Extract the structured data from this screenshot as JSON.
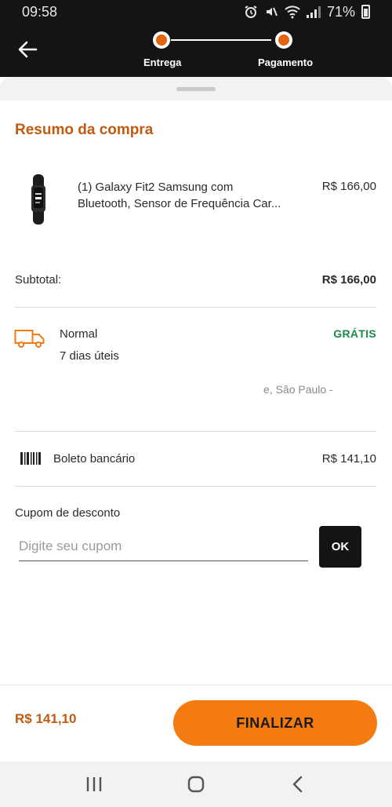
{
  "status_bar": {
    "time": "09:58",
    "battery": "71%",
    "icons": [
      "alarm-icon",
      "mute-icon",
      "wifi-icon",
      "signal-icon",
      "battery-icon"
    ]
  },
  "header": {
    "back_icon": "arrow-left-icon",
    "steps": [
      {
        "label": "Entrega"
      },
      {
        "label": "Pagamento"
      }
    ]
  },
  "summary": {
    "title": "Resumo da compra",
    "product": {
      "name": "(1) Galaxy Fit2 Samsung com Bluetooth, Sensor de Frequência Car...",
      "price": "R$ 166,00",
      "image_icon": "smartband-icon"
    },
    "subtotal_label": "Subtotal:",
    "subtotal_value": "R$ 166,00"
  },
  "shipping": {
    "icon": "truck-icon",
    "name": "Normal",
    "days": "7 dias úteis",
    "price": "GRÁTIS",
    "address": "e, São Paulo -"
  },
  "payment": {
    "icon": "barcode-icon",
    "method": "Boleto bancário",
    "value": "R$ 141,10"
  },
  "coupon": {
    "label": "Cupom de desconto",
    "placeholder": "Digite seu cupom",
    "value": "",
    "button": "OK"
  },
  "footer": {
    "total": "R$ 141,10",
    "finalize": "FINALIZAR"
  },
  "nav": {
    "icons": [
      "recent-apps-icon",
      "home-icon",
      "back-nav-icon"
    ]
  },
  "colors": {
    "accent": "#f47a12",
    "accent_text": "#c25a10",
    "free_green": "#1a8a4a",
    "dark": "#141414"
  }
}
